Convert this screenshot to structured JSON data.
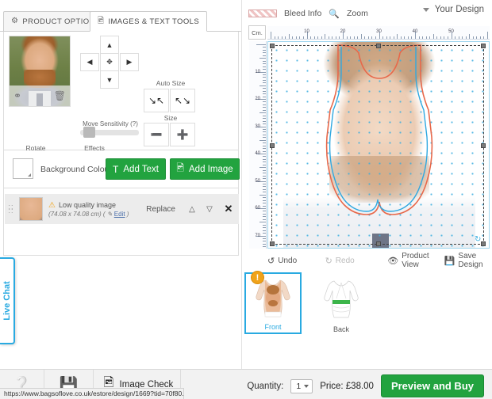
{
  "tabs": [
    {
      "label": "PRODUCT OPTIONS",
      "icon": "gear-icon",
      "glyph": "⚙",
      "active": false
    },
    {
      "label": "IMAGES & TEXT TOOLS",
      "icon": "image-icon",
      "glyph": "ὛC",
      "active": true
    }
  ],
  "tools": {
    "move": {
      "up": "⌃",
      "down": "⌄",
      "left": "‹",
      "right": "›",
      "center": "✥",
      "sensitivity_label": "Move Sensitivity (?)"
    },
    "auto_size": {
      "label": "Auto Size",
      "shrink": "↙",
      "grow": "↗"
    },
    "size": {
      "label": "Size",
      "zoom_out": "⊖",
      "zoom_in": "⊕"
    },
    "rotate": {
      "label": "Rotate",
      "ccw": "↺",
      "cw": "↻"
    },
    "effects": {
      "label": "Effects",
      "wand": "✦",
      "flip": "⬌"
    },
    "thumb_actions": {
      "link": "⚭",
      "delete": "Ὕ1"
    }
  },
  "background": {
    "label": "Background Colour:",
    "swatch_color": "#ffffff"
  },
  "buttons": {
    "add_text": {
      "label": "Add Text",
      "icon": "T"
    },
    "add_image": {
      "label": "Add Image",
      "icon": "ὛB"
    }
  },
  "layer": {
    "warning": "Low quality image",
    "dimensions": "(74.08 x 74.08 cm)",
    "edit_label": "Edit",
    "replace_label": "Replace",
    "move_up": "⌃",
    "move_down": "⌄",
    "close": "✕",
    "warn_icon": "⚠"
  },
  "live_chat": {
    "label": "Live Chat",
    "color": "#29aae1"
  },
  "design_toolbar": {
    "bleed_info": "Bleed Info",
    "zoom": "Zoom",
    "zoom_icon": "ὐD",
    "your_design": "Your Design"
  },
  "ruler": {
    "unit_label": "Cm.",
    "horizontal_ticks": [
      10,
      20,
      30,
      40,
      50
    ],
    "vertical_ticks": [
      10,
      20,
      30,
      40,
      50,
      60,
      70
    ]
  },
  "design_actions": {
    "undo": {
      "label": "Undo",
      "icon": "↶",
      "enabled": true
    },
    "redo": {
      "label": "Redo",
      "icon": "↷",
      "enabled": false
    },
    "product_view": {
      "label": "Product View",
      "icon": "ὄ1"
    },
    "save_design": {
      "label": "Save Design",
      "icon": "ὋE"
    }
  },
  "views": [
    {
      "label": "Front",
      "selected": true,
      "badge": "!"
    },
    {
      "label": "Back",
      "selected": false,
      "badge": ""
    }
  ],
  "bottom_bar": {
    "help_icon": "?",
    "save_icon": "ὋE",
    "image_check": {
      "label": "Image Check",
      "icon": "ὛC"
    },
    "quantity_label": "Quantity:",
    "quantity_value": "1",
    "price_label": "Price: £38.00",
    "buy_label": "Preview and Buy"
  },
  "status_bar": {
    "url": "https://www.bagsoflove.co.uk/estore/design/1669?tid=70f80..."
  }
}
